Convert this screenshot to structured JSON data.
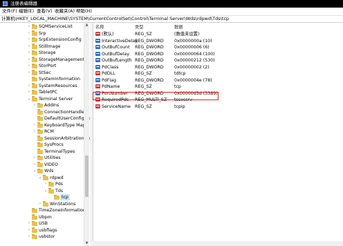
{
  "window": {
    "title": "注册表编辑器"
  },
  "menu": [
    "文件(F)",
    "编辑(E)",
    "查看(V)",
    "收藏夹(A)",
    "帮助(H)"
  ],
  "address": "计算机\\HKEY_LOCAL_MACHINE\\SYSTEM\\CurrentControlSet\\Control\\Terminal Server\\Wds\\rdpwd\\Tds\\tcp",
  "tree": [
    {
      "label": "SQMServiceList",
      "expander": "›"
    },
    {
      "label": "Srp",
      "expander": "›"
    },
    {
      "label": "SrpExtensionConfig",
      "expander": "›"
    },
    {
      "label": "StillImage",
      "expander": "›"
    },
    {
      "label": "Storage",
      "expander": "›"
    },
    {
      "label": "StorageManagement",
      "expander": "›"
    },
    {
      "label": "StorPort",
      "expander": "›"
    },
    {
      "label": "StSec",
      "expander": "›"
    },
    {
      "label": "SystemInformation",
      "expander": ""
    },
    {
      "label": "SystemResources",
      "expander": "›"
    },
    {
      "label": "TabletPC",
      "expander": "›"
    },
    {
      "label": "Terminal Server",
      "expander": "⌄"
    },
    {
      "label": "AddIns",
      "expander": "›"
    },
    {
      "label": "ConnectionHandler",
      "expander": ""
    },
    {
      "label": "DefaultUserConfigura",
      "expander": ""
    },
    {
      "label": "KeyboardType Mapp",
      "expander": "›"
    },
    {
      "label": "RCM",
      "expander": "›"
    },
    {
      "label": "SessionArbitrationHe",
      "expander": ""
    },
    {
      "label": "SysProcs",
      "expander": ""
    },
    {
      "label": "TerminalTypes",
      "expander": ""
    },
    {
      "label": "Utilities",
      "expander": "›"
    },
    {
      "label": "VIDEO",
      "expander": "›"
    },
    {
      "label": "Wds",
      "expander": "⌄"
    },
    {
      "label": "rdpwd",
      "expander": "⌄"
    },
    {
      "label": "Pds",
      "expander": "›"
    },
    {
      "label": "Tds",
      "expander": "⌄"
    },
    {
      "label": "tcp",
      "expander": ""
    },
    {
      "label": "WinStations",
      "expander": "›"
    },
    {
      "label": "TimeZoneInformation",
      "expander": ""
    },
    {
      "label": "Ubpm",
      "expander": ""
    },
    {
      "label": "USB",
      "expander": "›"
    },
    {
      "label": "usbflags",
      "expander": "›"
    },
    {
      "label": "usbstor",
      "expander": "›"
    }
  ],
  "columns": {
    "name": "名称",
    "type": "类型",
    "data": "数据"
  },
  "values": [
    {
      "icon": "sz",
      "name": "(默认)",
      "type": "REG_SZ",
      "data": "(数值未设置)"
    },
    {
      "icon": "dw",
      "name": "InteractiveDelay",
      "type": "REG_DWORD",
      "data": "0x0000000a (10)"
    },
    {
      "icon": "dw",
      "name": "OutBufCount",
      "type": "REG_DWORD",
      "data": "0x00000006 (6)"
    },
    {
      "icon": "dw",
      "name": "OutBufDelay",
      "type": "REG_DWORD",
      "data": "0x00000064 (100)"
    },
    {
      "icon": "dw",
      "name": "OutBufLength",
      "type": "REG_DWORD",
      "data": "0x00000212 (530)"
    },
    {
      "icon": "dw",
      "name": "PdClass",
      "type": "REG_DWORD",
      "data": "0x00000002 (2)"
    },
    {
      "icon": "sz",
      "name": "PdDLL",
      "type": "REG_SZ",
      "data": "tdtcp"
    },
    {
      "icon": "dw",
      "name": "PdFlag",
      "type": "REG_DWORD",
      "data": "0x0000004e (78)"
    },
    {
      "icon": "sz",
      "name": "PdName",
      "type": "REG_SZ",
      "data": "tcp"
    },
    {
      "icon": "dw",
      "name": "PortNumber",
      "type": "REG_DWORD",
      "data": "0x00000d3d (3389)"
    },
    {
      "icon": "sz",
      "name": "RequiredPds",
      "type": "REG_MULTI_SZ",
      "data": "tssecsrv"
    },
    {
      "icon": "sz",
      "name": "ServiceName",
      "type": "REG_SZ",
      "data": "tcpip"
    }
  ]
}
